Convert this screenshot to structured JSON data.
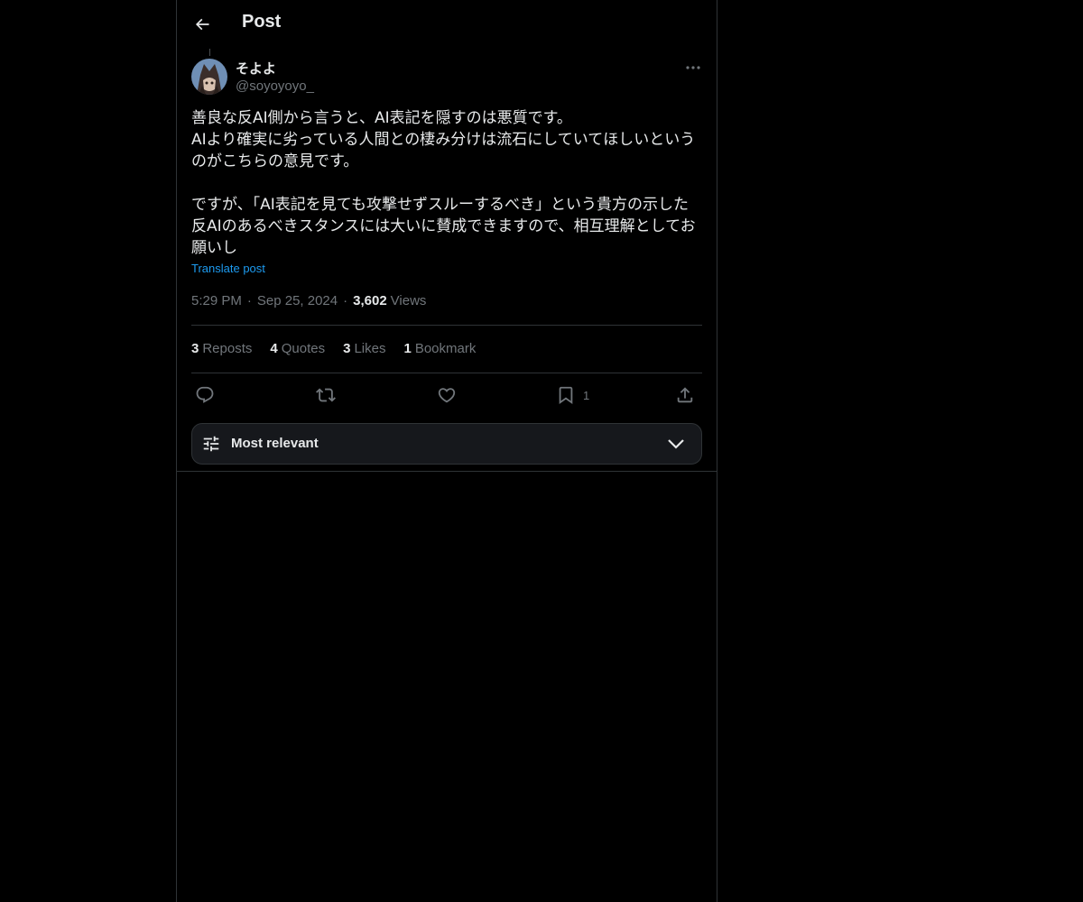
{
  "header": {
    "title": "Post"
  },
  "author": {
    "display_name": "そよよ",
    "handle": "@soyoyoyo_"
  },
  "tweet": {
    "text": "善良な反AI側から言うと、AI表記を隠すのは悪質です。\nAIより確実に劣っている人間との棲み分けは流石にしていてほしいというのがこちらの意見です。\n\nですが、「AI表記を見ても攻撃せずスルーするべき」という貴方の示した反AIのあるべきスタンスには大いに賛成できますので、相互理解としてお願いし",
    "translate_label": "Translate post",
    "time": "5:29 PM",
    "date": "Sep 25, 2024",
    "views_count": "3,602",
    "views_label": "Views",
    "separator": "·"
  },
  "stats": {
    "reposts": {
      "count": "3",
      "label": "Reposts"
    },
    "quotes": {
      "count": "4",
      "label": "Quotes"
    },
    "likes": {
      "count": "3",
      "label": "Likes"
    },
    "bookmarks": {
      "count": "1",
      "label": "Bookmark"
    }
  },
  "actions": {
    "reply": {
      "icon": "reply-icon"
    },
    "repost": {
      "icon": "repost-icon"
    },
    "like": {
      "icon": "heart-icon"
    },
    "bookmark": {
      "icon": "bookmark-icon",
      "count": "1"
    },
    "share": {
      "icon": "share-icon"
    }
  },
  "sort": {
    "label": "Most relevant",
    "icon": "tune-icon"
  },
  "colors": {
    "background": "#000000",
    "text": "#e7e9ea",
    "muted": "#71767b",
    "accent": "#1d9bf0",
    "border": "#2f3336"
  }
}
